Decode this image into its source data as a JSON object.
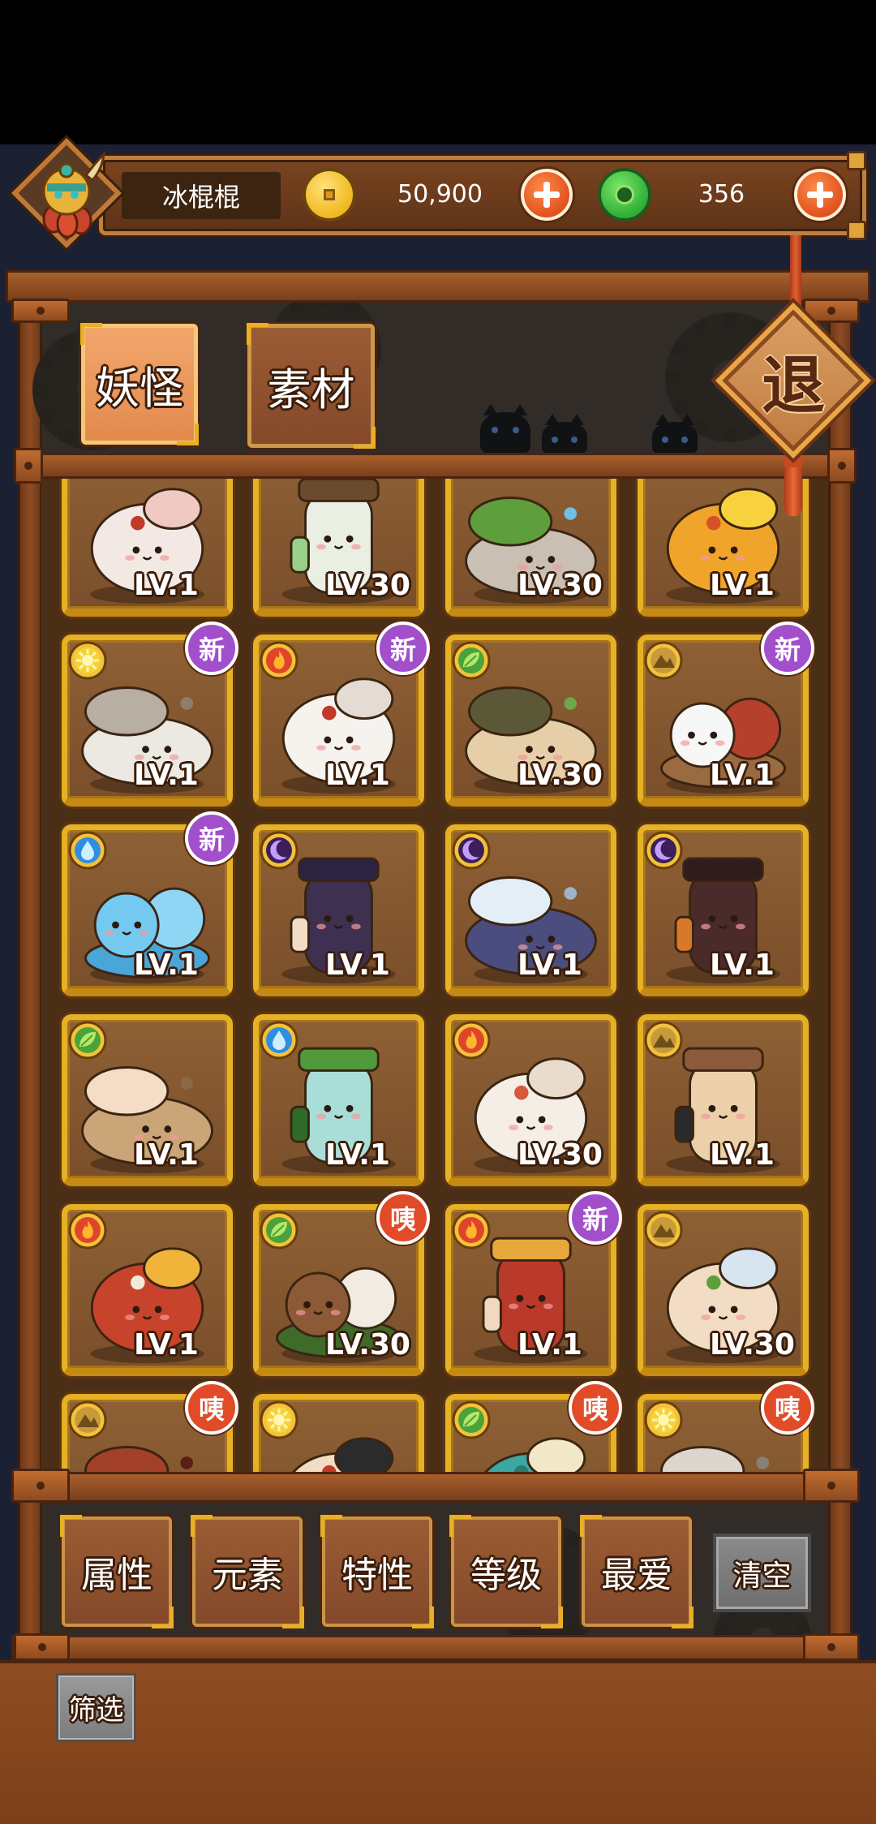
{
  "header": {
    "player_name": "冰棍棍",
    "coins": "50,900",
    "gems": "356"
  },
  "tabs": [
    {
      "label": "妖怪",
      "selected": true
    },
    {
      "label": "素材",
      "selected": false
    }
  ],
  "exit": {
    "label": "退"
  },
  "elements": {
    "sun": {
      "fill": "#f6d23a",
      "symbol": "#fff6b0"
    },
    "fire": {
      "fill": "#e0452a",
      "symbol": "#ffb52e"
    },
    "leaf": {
      "fill": "#4aa23a",
      "symbol": "#b4e86a"
    },
    "earth": {
      "fill": "#c79a3a",
      "symbol": "#6e4f1a"
    },
    "water": {
      "fill": "#2f8ee0",
      "symbol": "#cdeeff"
    },
    "dark": {
      "fill": "#3b1f5c",
      "symbol": "#c79cff"
    }
  },
  "monsters": [
    {
      "art": "pig",
      "level": "LV.1",
      "element": null,
      "badge": null,
      "colors": {
        "body": "#f3e9e4",
        "accent": "#efc9c2",
        "detail": "#c0392b"
      }
    },
    {
      "art": "cup",
      "level": "LV.30",
      "element": null,
      "badge": null,
      "colors": {
        "body": "#e9efe2",
        "accent": "#6b4a2e",
        "detail": "#9ad08a"
      }
    },
    {
      "art": "leaf-rain",
      "level": "LV.30",
      "element": null,
      "badge": null,
      "colors": {
        "body": "#c9bfb2",
        "accent": "#5f9e3c",
        "detail": "#6ec0e8"
      }
    },
    {
      "art": "fish",
      "level": "LV.1",
      "element": null,
      "badge": null,
      "colors": {
        "body": "#f0a429",
        "accent": "#f7d23e",
        "detail": "#d8502a"
      }
    },
    {
      "art": "chameleon",
      "level": "LV.1",
      "element": "sun",
      "badge": "新",
      "colors": {
        "body": "#ece8e2",
        "accent": "#b8aea2",
        "detail": "#8a7f72"
      }
    },
    {
      "art": "cat",
      "level": "LV.1",
      "element": "fire",
      "badge": "新",
      "colors": {
        "body": "#f6f3ef",
        "accent": "#e4dcd2",
        "detail": "#c0392b"
      }
    },
    {
      "art": "turtle",
      "level": "LV.30",
      "element": "leaf",
      "badge": null,
      "colors": {
        "body": "#e6cfa8",
        "accent": "#5b5838",
        "detail": "#6aa84a"
      }
    },
    {
      "art": "dango",
      "level": "LV.1",
      "element": "earth",
      "badge": "新",
      "colors": {
        "body": "#f7f7f7",
        "accent": "#b5402c",
        "detail": "#9a6a40"
      }
    },
    {
      "art": "slime",
      "level": "LV.1",
      "element": "water",
      "badge": "新",
      "colors": {
        "body": "#74c9f0",
        "accent": "#8fd6f5",
        "detail": "#4aa6d8"
      }
    },
    {
      "art": "ninja",
      "level": "LV.1",
      "element": "dark",
      "badge": null,
      "colors": {
        "body": "#3d3050",
        "accent": "#2c2340",
        "detail": "#f2dcc4"
      }
    },
    {
      "art": "spoon",
      "level": "LV.1",
      "element": "dark",
      "badge": null,
      "colors": {
        "body": "#4a4d7e",
        "accent": "#e3eef7",
        "detail": "#9fb4c8"
      }
    },
    {
      "art": "boxman",
      "level": "LV.1",
      "element": "dark",
      "badge": null,
      "colors": {
        "body": "#4b2a2a",
        "accent": "#2f1c1c",
        "detail": "#d8782a"
      }
    },
    {
      "art": "log",
      "level": "LV.1",
      "element": "leaf",
      "badge": null,
      "colors": {
        "body": "#c9a577",
        "accent": "#f3dec5",
        "detail": "#8a6a44"
      }
    },
    {
      "art": "vase",
      "level": "LV.1",
      "element": "water",
      "badge": null,
      "colors": {
        "body": "#a9ddd7",
        "accent": "#4f9a3a",
        "detail": "#2f6a2a"
      }
    },
    {
      "art": "rat",
      "level": "LV.30",
      "element": "fire",
      "badge": null,
      "colors": {
        "body": "#f5eee6",
        "accent": "#e9dccd",
        "detail": "#d65a3a"
      }
    },
    {
      "art": "potato",
      "level": "LV.1",
      "element": "earth",
      "badge": null,
      "colors": {
        "body": "#ecd0a9",
        "accent": "#8a5a3a",
        "detail": "#2a2a2a"
      }
    },
    {
      "art": "leaf-pick",
      "level": "LV.1",
      "element": "fire",
      "badge": null,
      "colors": {
        "body": "#c8432b",
        "accent": "#f0b43a",
        "detail": "#f3ead8"
      }
    },
    {
      "art": "gourd",
      "level": "LV.30",
      "element": "leaf",
      "badge": "咦",
      "colors": {
        "body": "#8c5a36",
        "accent": "#f1ebe2",
        "detail": "#3e6a2a"
      }
    },
    {
      "art": "scarf",
      "level": "LV.1",
      "element": "fire",
      "badge": "新",
      "colors": {
        "body": "#b9392a",
        "accent": "#e6a83a",
        "detail": "#f0d9c0"
      }
    },
    {
      "art": "fatman",
      "level": "LV.30",
      "element": "earth",
      "badge": null,
      "colors": {
        "body": "#f3dcc4",
        "accent": "#d8e4f0",
        "detail": "#5aa03a"
      }
    },
    {
      "art": "bowl",
      "level": null,
      "element": "earth",
      "badge": "咦",
      "colors": {
        "body": "#7d2c1e",
        "accent": "#a3402a",
        "detail": "#5a1e14"
      }
    },
    {
      "art": "hatman",
      "level": null,
      "element": "sun",
      "badge": null,
      "colors": {
        "body": "#f3dcc4",
        "accent": "#2b2b2b",
        "detail": "#c0392b"
      }
    },
    {
      "art": "tealhat",
      "level": null,
      "element": "leaf",
      "badge": "咦",
      "colors": {
        "body": "#3ba7a0",
        "accent": "#f2e8c8",
        "detail": "#2a7a70"
      }
    },
    {
      "art": "bird",
      "level": null,
      "element": "sun",
      "badge": "咦",
      "colors": {
        "body": "#f2eee8",
        "accent": "#dcd6ce",
        "detail": "#8a8076"
      }
    }
  ],
  "filters": {
    "buttons": [
      "属性",
      "元素",
      "特性",
      "等级",
      "最爱"
    ],
    "clear_label": "清空",
    "filter_label": "筛选"
  }
}
